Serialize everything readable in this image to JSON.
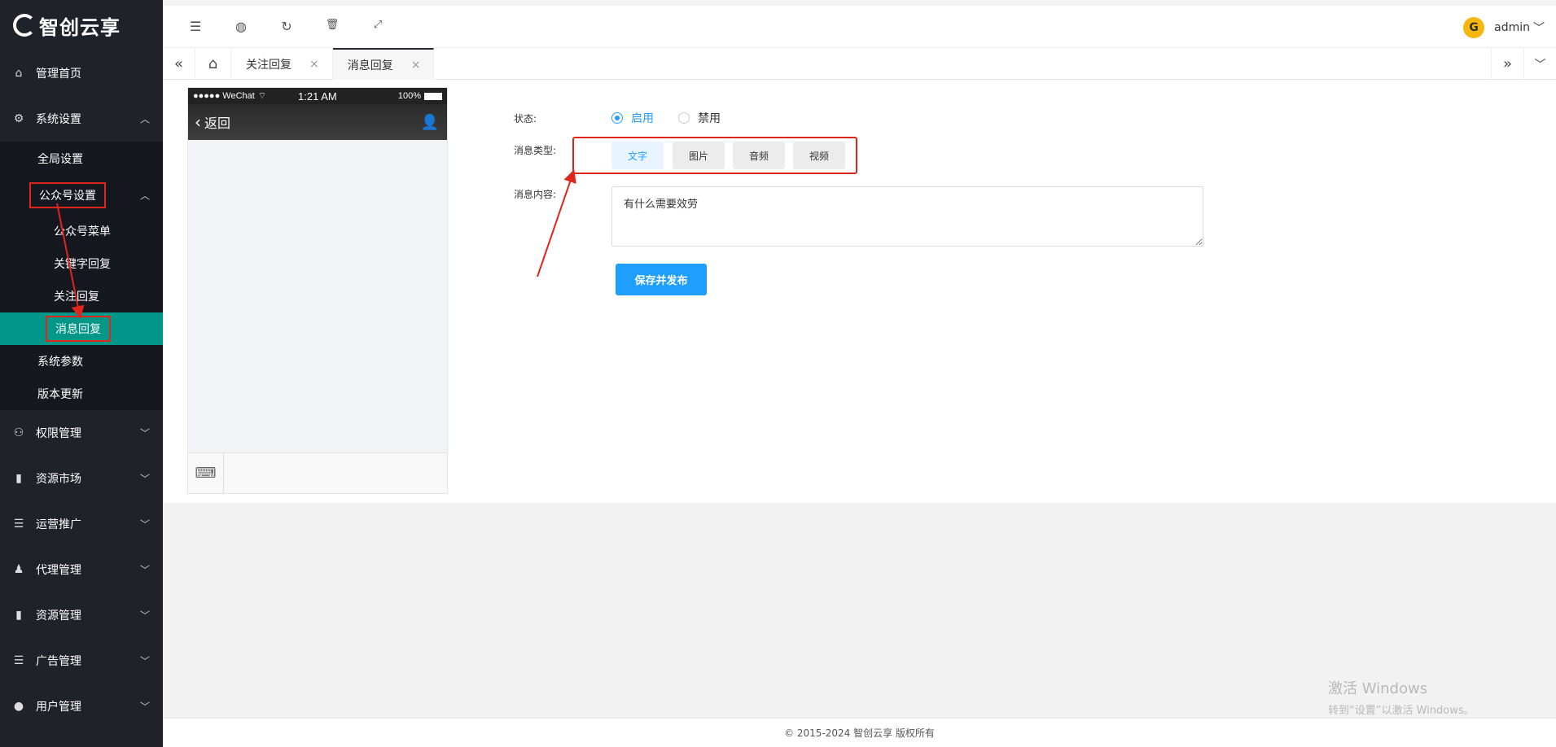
{
  "logo": "智创云享",
  "sidebar": {
    "home": "管理首页",
    "system": "系统设置",
    "global": "全局设置",
    "mp_settings": "公众号设置",
    "mp_menu": "公众号菜单",
    "keyword_reply": "关键字回复",
    "follow_reply": "关注回复",
    "message_reply": "消息回复",
    "sys_params": "系统参数",
    "version": "版本更新",
    "permission": "权限管理",
    "resource_market": "资源市场",
    "operations": "运营推广",
    "agent": "代理管理",
    "resource": "资源管理",
    "ads": "广告管理",
    "users": "用户管理"
  },
  "header": {
    "username": "admin"
  },
  "tabs": [
    {
      "label": "关注回复"
    },
    {
      "label": "消息回复"
    }
  ],
  "phone": {
    "carrier": "●●●●● WeChat",
    "time": "1:21 AM",
    "battery": "100%",
    "back": "返回"
  },
  "form": {
    "status_label": "状态:",
    "status_on": "启用",
    "status_off": "禁用",
    "type_label": "消息类型:",
    "types": [
      "文字",
      "图片",
      "音频",
      "视频"
    ],
    "content_label": "消息内容:",
    "content_value": "有什么需要效劳",
    "save": "保存并发布"
  },
  "watermark": {
    "line1": "激活 Windows",
    "line2": "转到“设置”以激活 Windows。"
  },
  "footer": "© 2015-2024 智创云享 版权所有"
}
